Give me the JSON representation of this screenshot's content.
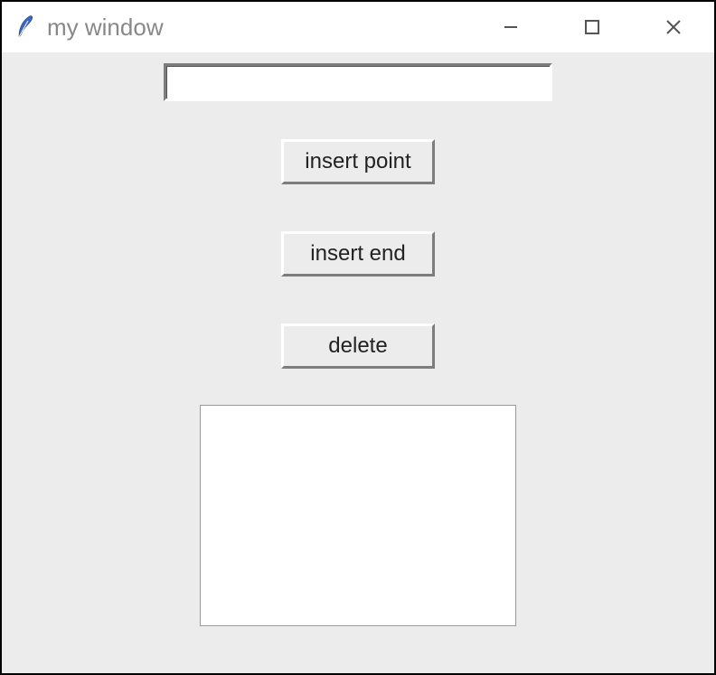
{
  "window": {
    "title": "my window"
  },
  "entry": {
    "value": ""
  },
  "buttons": {
    "insert_point": "insert point",
    "insert_end": "insert end",
    "delete": "delete"
  },
  "textbox": {
    "value": ""
  }
}
